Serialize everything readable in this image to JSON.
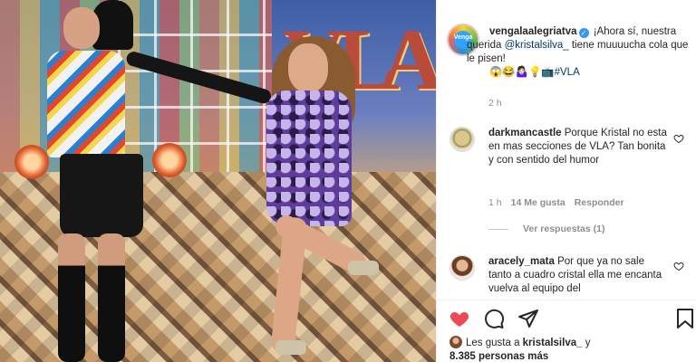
{
  "post": {
    "username": "vengalaalegriatva",
    "caption_before": " ¡Ahora sí, nuestra querida ",
    "mention": "@kristalsilva_",
    "caption_after": " tiene muuuucha cola que le pisen!",
    "caption_emoji": "😱😂🤷🏻‍♀️💡📺",
    "hashtag": "#VLA",
    "time": "2 h",
    "avatar_text": "Venga"
  },
  "comments": [
    {
      "username": "darkmancastle",
      "text": " Porque Kristal no esta en mas secciones de VLA? Tan bonita y con sentido del humor",
      "time": "1 h",
      "likes": "14 Me gusta",
      "reply": "Responder",
      "view_replies": "Ver respuestas (1)"
    },
    {
      "username": "aracely_mata",
      "text": " Por que ya no sale tanto a cuadro cristal ella me encanta vuelva al equipo del"
    }
  ],
  "likes_line": {
    "prefix": "Les gusta a ",
    "user": "kristalsilva_",
    "conj": " y",
    "count": "8.385 personas más"
  },
  "scene": {
    "letters": [
      "V",
      "L",
      "A"
    ]
  },
  "colors": {
    "heart_filled": "#ed4956",
    "link": "#00376b",
    "verified": "#3897f0"
  },
  "icons": [
    "heart-icon",
    "comment-icon",
    "share-icon",
    "bookmark-icon",
    "verified-icon"
  ]
}
